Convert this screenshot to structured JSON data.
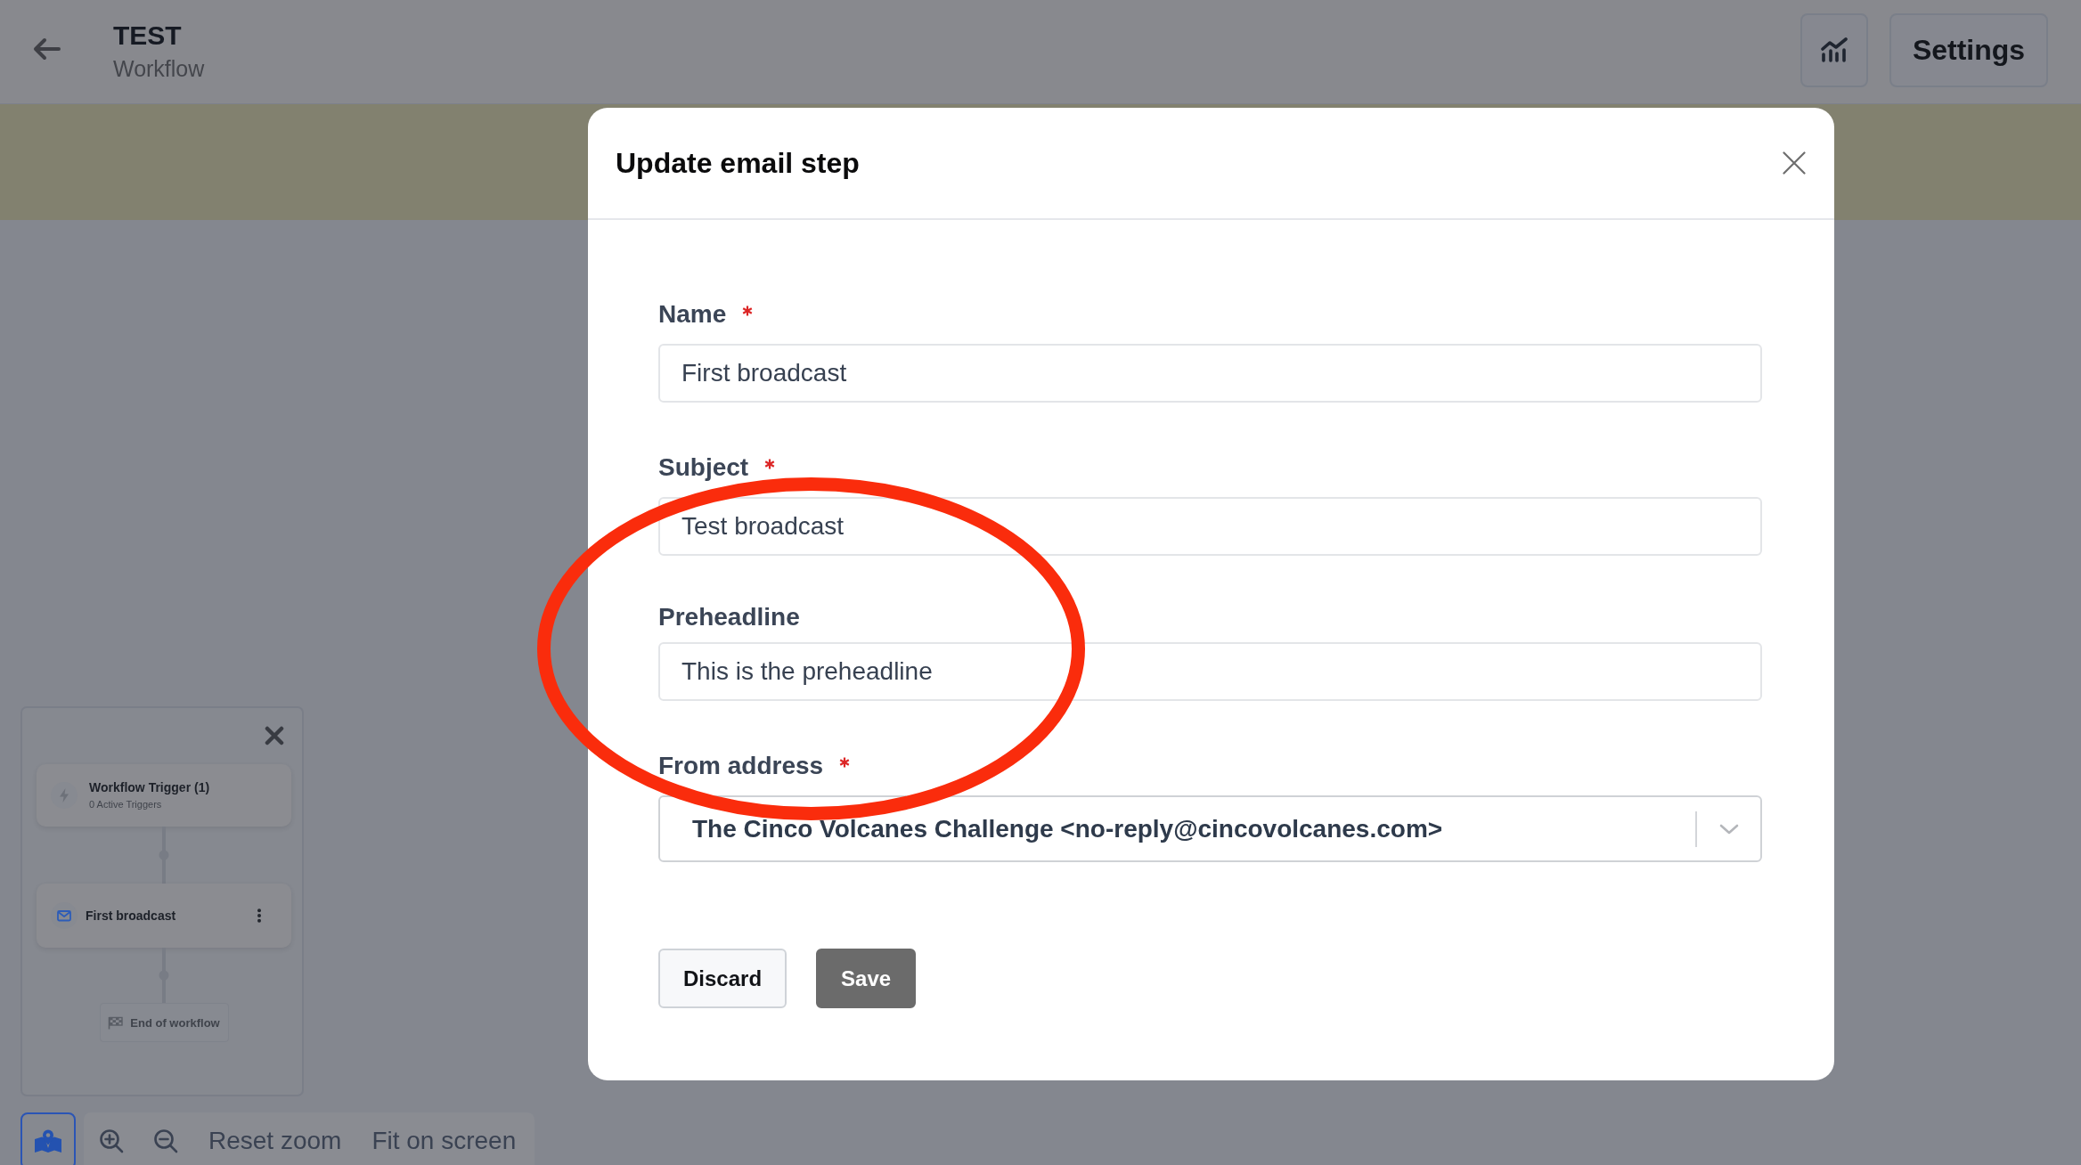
{
  "header": {
    "title": "TEST",
    "subtitle": "Workflow",
    "settings_button": "Settings"
  },
  "dialog": {
    "title": "Update email step",
    "fields": [
      {
        "kind": "text",
        "label": "Name",
        "required": true,
        "value": "First broadcast"
      },
      {
        "kind": "text",
        "label": "Subject",
        "required": true,
        "value": "Test broadcast"
      },
      {
        "kind": "text",
        "label": "Preheadline",
        "required": false,
        "value": "This is the preheadline"
      },
      {
        "kind": "select",
        "label": "From address",
        "required": true,
        "value": "The Cinco Volcanes Challenge <no-reply@cincovolcanes.com>"
      }
    ],
    "buttons": [
      {
        "kind": "secondary",
        "label": "Discard"
      },
      {
        "kind": "primary",
        "label": "Save"
      }
    ]
  },
  "minimap": {
    "nodes": [
      {
        "kind": "trigger",
        "title": "Workflow Trigger (1)",
        "subtitle": "0 Active Triggers"
      },
      {
        "kind": "email",
        "title": "First broadcast"
      },
      {
        "kind": "end",
        "title": "End of workflow"
      }
    ]
  },
  "zoom_toolbar": {
    "map_button": {
      "selected": true
    },
    "actions": [
      "Reset zoom",
      "Fit on screen"
    ]
  },
  "annotation": {
    "kind": "ellipse"
  }
}
